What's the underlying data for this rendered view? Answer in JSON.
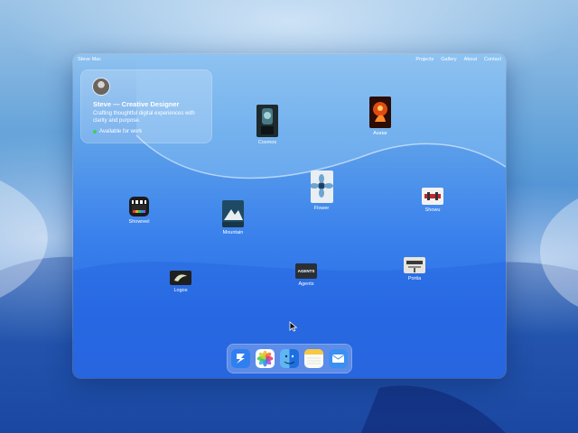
{
  "window": {
    "brand": "Steve Mac",
    "nav": [
      "Projects",
      "Gallery",
      "About",
      "Contact"
    ]
  },
  "profile": {
    "name": "Steve — Creative Designer",
    "tagline": "Crafting thoughtful digital experiences with clarity and purpose.",
    "status": "Available for work",
    "status_color": "#3ad05a"
  },
  "desktop_icons": [
    {
      "label": "Cosmos",
      "icon": "cosmos-thumbnail-icon"
    },
    {
      "label": "Avatar",
      "icon": "avatar-thumbnail-icon"
    },
    {
      "label": "Flower",
      "icon": "flower-thumbnail-icon"
    },
    {
      "label": "Showu",
      "icon": "showu-thumbnail-icon"
    },
    {
      "label": "Showreel",
      "icon": "clapperboard-icon"
    },
    {
      "label": "Mountain",
      "icon": "mountain-thumbnail-icon"
    },
    {
      "label": "Logos",
      "icon": "logos-thumbnail-icon"
    },
    {
      "label": "Agents",
      "icon": "agents-thumbnail-icon",
      "text": "AGENTS"
    },
    {
      "label": "Portia",
      "icon": "portia-thumbnail-icon"
    }
  ],
  "dock": [
    "finder-style-app-icon",
    "photos-icon",
    "finder-icon",
    "notes-icon",
    "mail-icon"
  ],
  "colors": {
    "accent_blue": "#2a6ee6",
    "window_top": "#8fc2ee"
  }
}
